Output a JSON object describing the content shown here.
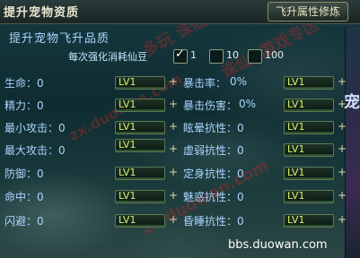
{
  "window": {
    "title": "提升宠物资质",
    "tab_label": "飞升属性修炼"
  },
  "section": {
    "subtitle": "提升宠物飞升品质"
  },
  "bean_option": {
    "label": "每次强化消耗仙豆",
    "choices": [
      {
        "label": "1",
        "checked": true
      },
      {
        "label": "10",
        "checked": false
      },
      {
        "label": "100",
        "checked": false
      }
    ]
  },
  "left_stats": [
    {
      "label": "生命：0",
      "level": "LV1"
    },
    {
      "label": "精力：0",
      "level": "LV1"
    },
    {
      "label": "最小攻击：0",
      "level": "LV1"
    },
    {
      "label": "最大攻击：0",
      "level": "LV1"
    },
    {
      "label": "防御：0",
      "level": "LV1"
    },
    {
      "label": "命中：0",
      "level": "LV1"
    },
    {
      "label": "闪避：0",
      "level": "LV1"
    }
  ],
  "right_stats": [
    {
      "label": "暴击率：",
      "value": "0%",
      "level": "LV1"
    },
    {
      "label": "暴击伤害：",
      "value": "0%",
      "level": "LV1"
    },
    {
      "label": "眩晕抗性：0",
      "value": "",
      "level": "LV1"
    },
    {
      "label": "虚弱抗性：0",
      "value": "",
      "level": "LV1"
    },
    {
      "label": "定身抗性：0",
      "value": "",
      "level": "LV1"
    },
    {
      "label": "魅惑抗性：0",
      "value": "",
      "level": "LV1"
    },
    {
      "label": "昏睡抗性：0",
      "value": "",
      "level": "LV1"
    }
  ],
  "plus_glyph": "+",
  "watermarks": [
    "多玩 诛仙2游戏专区",
    "zx.duowan.com",
    "诛仙2游戏专区",
    "zx.duowan.com"
  ],
  "footer": "bbs.duowan.com",
  "right_edge_glyph": "宠"
}
